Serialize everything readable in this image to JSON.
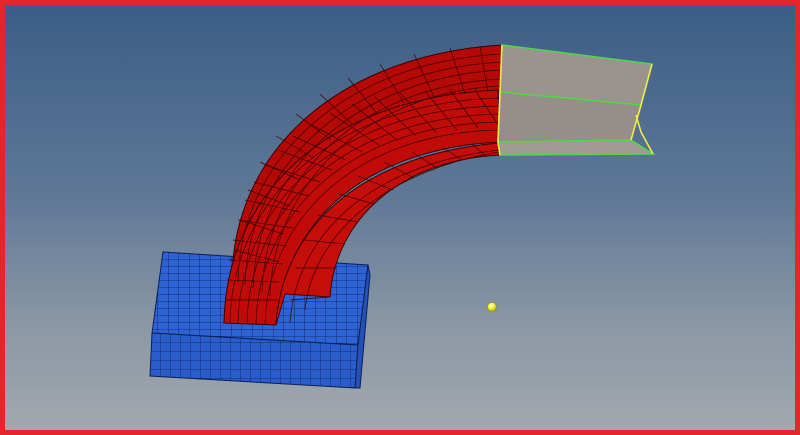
{
  "viewport": {
    "border_color": "#e3262c",
    "background_top": "#3b5d86",
    "background_bottom": "#a3a8ad"
  },
  "model": {
    "base_block": {
      "color": "#2e63d6",
      "mesh": "hex"
    },
    "curved_pipe": {
      "color": "#c10b08",
      "mesh": "hex"
    },
    "extension_surface": {
      "color": "#9a938e",
      "edge_color": "#4dd84a"
    },
    "outline_edges": {
      "color": "#f2e84a"
    },
    "rotation_center_marker": {
      "color": "#f5f52a"
    }
  },
  "icons": {
    "rotation_center": "yellow-sphere-icon"
  }
}
